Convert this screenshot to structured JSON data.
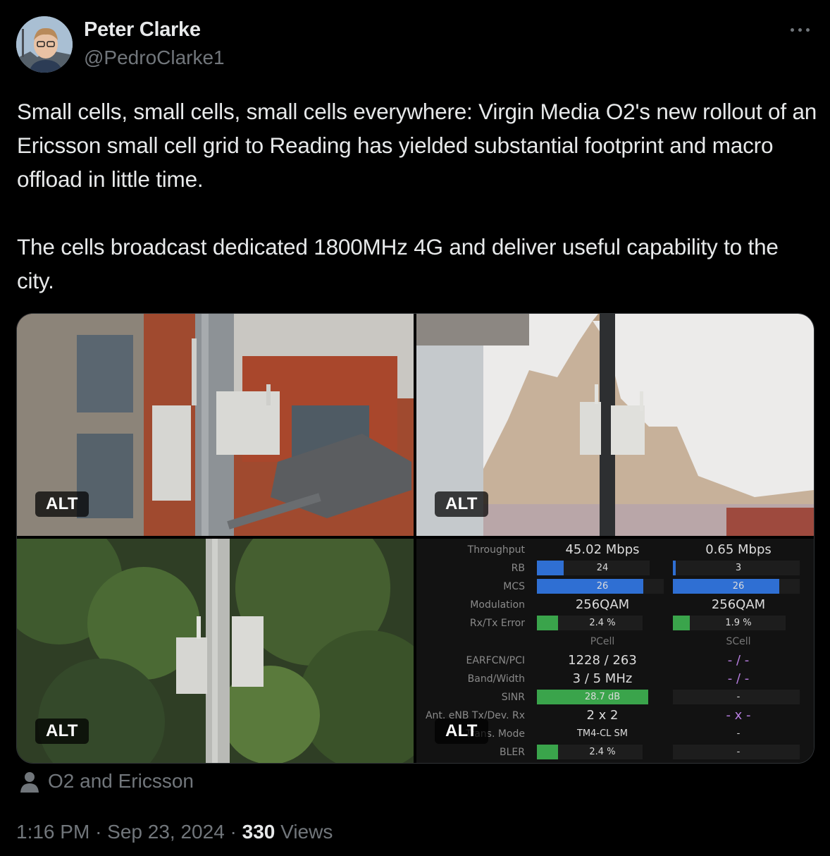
{
  "author": {
    "name": "Peter Clarke",
    "handle": "@PedroClarke1"
  },
  "tweet_text": "Small cells, small cells, small cells everywhere: Virgin Media O2's new rollout of an Ericsson small cell grid to Reading has yielded substantial footprint and macro offload in little time.\n\nThe cells broadcast dedicated 1800MHz 4G and deliver useful capability to the city.",
  "media": {
    "alt_label": "ALT",
    "stats": {
      "labels": {
        "throughput": "Throughput",
        "rb": "RB",
        "mcs": "MCS",
        "modulation": "Modulation",
        "rxtx_error": "Rx/Tx Error",
        "earfcn": "EARFCN/PCI",
        "band": "Band/Width",
        "sinr": "SINR",
        "ant": "Ant. eNB Tx/Dev. Rx",
        "trans": "Trans. Mode",
        "bler": "BLER"
      },
      "pcell": {
        "header": "PCell",
        "throughput": "45.02 Mbps",
        "rb": "24",
        "rb_fill": 0.24,
        "mcs": "26",
        "mcs_fill": 0.84,
        "modulation": "256QAM",
        "rxtx_error": "2.4 %",
        "rxtx_fill": 0.2,
        "earfcn": "1228 / 263",
        "band": "3 / 5 MHz",
        "sinr": "28.7 dB",
        "sinr_fill": 1.0,
        "ant": "2 x 2",
        "trans": "TM4-CL SM",
        "bler": "2.4 %",
        "bler_fill": 0.2
      },
      "scell": {
        "header": "SCell",
        "throughput": "0.65 Mbps",
        "rb": "3",
        "rb_fill": 0.02,
        "mcs": "26",
        "mcs_fill": 0.84,
        "modulation": "256QAM",
        "rxtx_error": "1.9 %",
        "rxtx_fill": 0.15,
        "earfcn": "- / -",
        "band": "- / -",
        "sinr": "-",
        "ant": "- x -",
        "trans": "-",
        "bler": "-"
      }
    }
  },
  "credit": "O2 and Ericsson",
  "meta": {
    "time": "1:16 PM",
    "sep": "·",
    "date": "Sep 23, 2024",
    "views_count": "330",
    "views_label": "Views"
  },
  "colors": {
    "accent_blue": "#2f6fd3",
    "accent_green": "#3aa44b",
    "muted": "#71767b"
  }
}
